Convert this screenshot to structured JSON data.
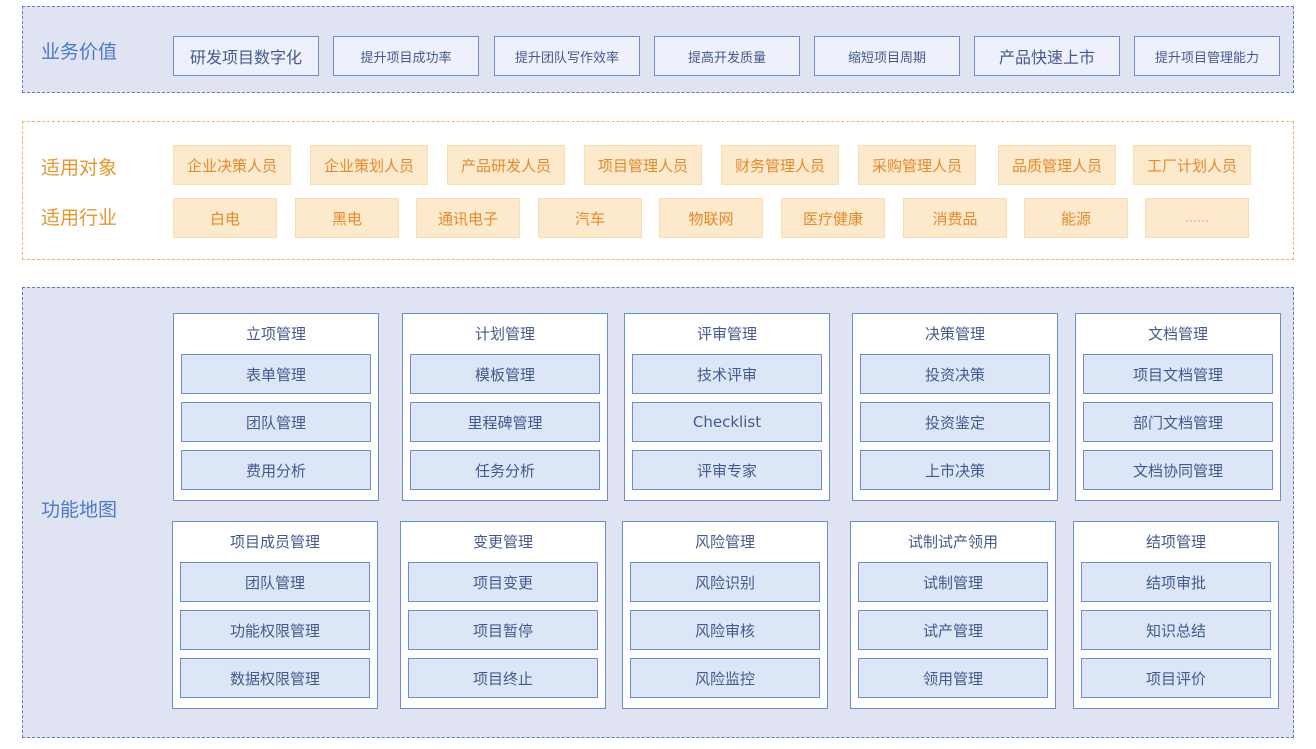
{
  "business_value": {
    "label": "业务价值",
    "items": [
      "研发项目数字化",
      "提升项目成功率",
      "提升团队写作效率",
      "提高开发质量",
      "缩短项目周期",
      "产品快速上市",
      "提升项目管理能力"
    ]
  },
  "applicable": {
    "target_label": "适用对象",
    "targets": [
      "企业决策人员",
      "企业策划人员",
      "产品研发人员",
      "项目管理人员",
      "财务管理人员",
      "采购管理人员",
      "品质管理人员",
      "工厂计划人员"
    ],
    "industry_label": "适用行业",
    "industries": [
      "白电",
      "黑电",
      "通讯电子",
      "汽车",
      "物联网",
      "医疗健康",
      "消费品",
      "能源",
      "......"
    ]
  },
  "function_map": {
    "label": "功能地图",
    "cards": [
      {
        "title": "立项管理",
        "items": [
          "表单管理",
          "团队管理",
          "费用分析"
        ]
      },
      {
        "title": "计划管理",
        "items": [
          "模板管理",
          "里程碑管理",
          "任务分析"
        ]
      },
      {
        "title": "评审管理",
        "items": [
          "技术评审",
          "Checklist",
          "评审专家"
        ]
      },
      {
        "title": "决策管理",
        "items": [
          "投资决策",
          "投资鉴定",
          "上市决策"
        ]
      },
      {
        "title": "文档管理",
        "items": [
          "项目文档管理",
          "部门文档管理",
          "文档协同管理"
        ]
      },
      {
        "title": "项目成员管理",
        "items": [
          "团队管理",
          "功能权限管理",
          "数据权限管理"
        ]
      },
      {
        "title": "变更管理",
        "items": [
          "项目变更",
          "项目暂停",
          "项目终止"
        ]
      },
      {
        "title": "风险管理",
        "items": [
          "风险识别",
          "风险审核",
          "风险监控"
        ]
      },
      {
        "title": "试制试产领用",
        "items": [
          "试制管理",
          "试产管理",
          "领用管理"
        ]
      },
      {
        "title": "结项管理",
        "items": [
          "结项审批",
          "知识总结",
          "项目评价"
        ]
      }
    ]
  },
  "colors": {
    "blue_section_bg": "#e0e3f1",
    "blue_border": "#6f8ec8",
    "blue_text": "#455a8c",
    "blue_label": "#4a7ac8",
    "orange_border": "#f0b45a",
    "orange_fill": "#fde9cc",
    "orange_text": "#e48a2b",
    "item_fill": "#dce6f7"
  }
}
